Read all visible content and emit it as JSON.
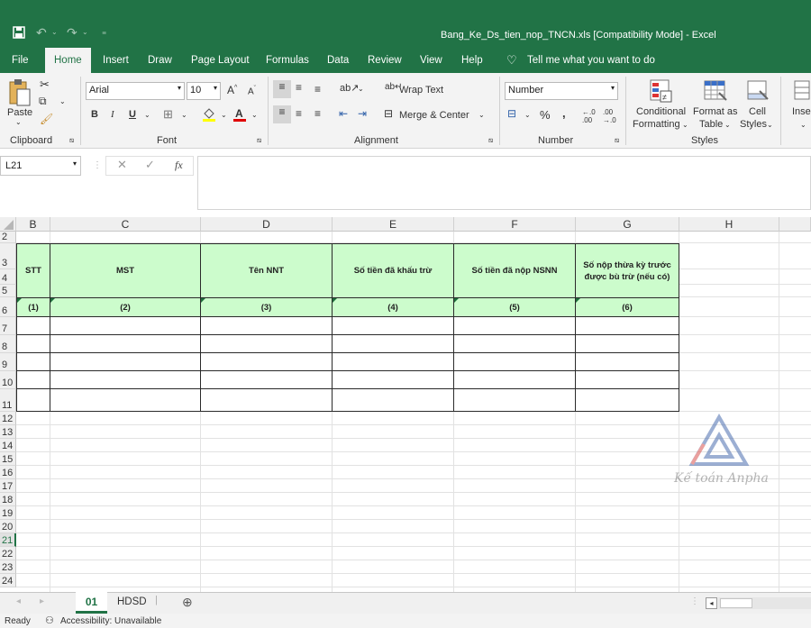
{
  "title": {
    "document": "Bang_Ke_Ds_tien_nop_TNCN.xls  [Compatibility Mode]  -  Excel"
  },
  "menu": [
    {
      "label": "File"
    },
    {
      "label": "Home"
    },
    {
      "label": "Insert"
    },
    {
      "label": "Draw"
    },
    {
      "label": "Page Layout"
    },
    {
      "label": "Formulas"
    },
    {
      "label": "Data"
    },
    {
      "label": "Review"
    },
    {
      "label": "View"
    },
    {
      "label": "Help"
    },
    {
      "label": "Tell me what you want to do"
    }
  ],
  "ribbon": {
    "clipboard": {
      "paste": "Paste",
      "label": "Clipboard"
    },
    "font": {
      "name": "Arial",
      "size": "10",
      "bold": "B",
      "italic": "I",
      "underline": "U",
      "label": "Font"
    },
    "alignment": {
      "wrap": "Wrap Text",
      "merge": "Merge & Center",
      "label": "Alignment"
    },
    "number": {
      "format": "Number",
      "percent": "%",
      "comma": ",",
      "label": "Number"
    },
    "styles": {
      "conditional": "Conditional",
      "formatting": "Formatting",
      "format_as": "Format as",
      "table": "Table",
      "cell": "Cell",
      "cell_styles": "Styles",
      "label": "Styles"
    },
    "insert": "Inser"
  },
  "formula": {
    "namebox": "L21",
    "fx": "fx",
    "content": ""
  },
  "columns": [
    "B",
    "C",
    "D",
    "E",
    "F",
    "G",
    "H"
  ],
  "rows": [
    "2",
    "3",
    "4",
    "5",
    "6",
    "7",
    "8",
    "9",
    "10",
    "11",
    "12",
    "13",
    "14",
    "15",
    "16",
    "17",
    "18",
    "19",
    "20",
    "21",
    "22",
    "23",
    "24"
  ],
  "table": {
    "headers": [
      "STT",
      "MST",
      "Tên NNT",
      "Số tiền đã khấu trừ",
      "Số tiền đã nộp NSNN",
      "Số nộp thừa kỳ trước được bù trừ (nếu có)"
    ],
    "numbers": [
      "(1)",
      "(2)",
      "(3)",
      "(4)",
      "(5)",
      "(6)"
    ]
  },
  "watermark": {
    "text": "Kế toán Anpha"
  },
  "sheets": [
    {
      "label": "01",
      "active": true
    },
    {
      "label": "HDSD",
      "active": false
    }
  ],
  "status": {
    "ready": "Ready",
    "accessibility": "Accessibility: Unavailable"
  },
  "colors": {
    "excel_green": "#217346",
    "header_fill": "#ccfccc"
  }
}
